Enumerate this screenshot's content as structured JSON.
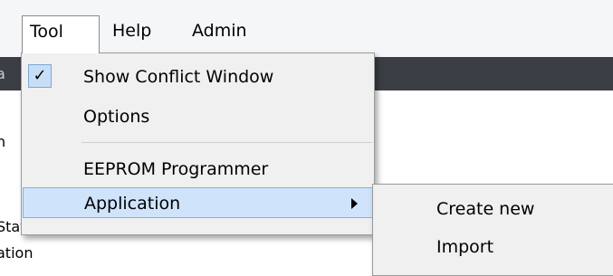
{
  "menubar": {
    "items": [
      {
        "label": "Tool"
      },
      {
        "label": "Help"
      },
      {
        "label": "Admin"
      }
    ]
  },
  "background": {
    "fragment_1": "a",
    "fragment_2": "n",
    "fragment_3": "State Machine",
    "fragment_4": "ation"
  },
  "tool_menu": {
    "items": [
      {
        "label": "Show Conflict Window",
        "checked": true
      },
      {
        "label": "Options"
      },
      {
        "label": "EEPROM Programmer"
      },
      {
        "label": "Application",
        "has_submenu": true,
        "highlighted": true
      }
    ]
  },
  "application_submenu": {
    "items": [
      {
        "label": "Create new"
      },
      {
        "label": "Import"
      }
    ]
  },
  "colors": {
    "highlight": "#cfe3fb",
    "highlight_border": "#7fb0ea",
    "menu_background": "#f0f0f0",
    "dark_bar": "#3b3f45"
  },
  "icons": {
    "check": "check-icon",
    "submenu_arrow": "chevron-right-icon"
  }
}
